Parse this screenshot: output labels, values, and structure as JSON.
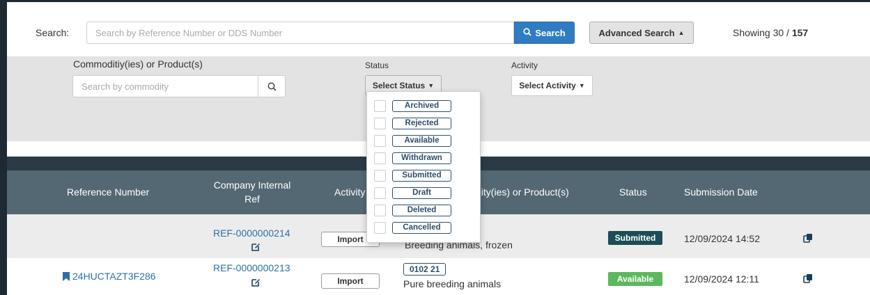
{
  "search": {
    "label": "Search:",
    "placeholder": "Search by Reference Number or DDS Number",
    "button_label": "Search",
    "advanced_label": "Advanced Search",
    "showing_prefix": "Showing 30 / ",
    "showing_total": "157"
  },
  "advanced": {
    "commodity_label": "Commoditiy(ies) or Product(s)",
    "commodity_placeholder": "Search by commodity",
    "status_label": "Status",
    "status_button": "Select Status",
    "activity_label": "Activity",
    "activity_button": "Select Activity"
  },
  "status_options": [
    "Archived",
    "Rejected",
    "Available",
    "Withdrawn",
    "Submitted",
    "Draft",
    "Deleted",
    "Cancelled"
  ],
  "table": {
    "headers": {
      "reference": "Reference Number",
      "internal_ref_1": "Company Internal",
      "internal_ref_2": "Ref",
      "activity": "Activity",
      "commodity": "Commodity(ies) or Product(s)",
      "status": "Status",
      "date": "Submission Date"
    },
    "rows": [
      {
        "reference": "",
        "internal_ref": "REF-0000000214",
        "activity": "Import",
        "code": "",
        "commodity": "Breeding animals, frozen",
        "status": "Submitted",
        "date": "12/09/2024 14:52"
      },
      {
        "reference": "24HUCTAZT3F286",
        "internal_ref": "REF-0000000213",
        "activity": "Import",
        "code": "0102 21",
        "commodity": "Pure breeding animals",
        "status": "Available",
        "date": "12/09/2024 12:11"
      }
    ]
  },
  "colors": {
    "primary": "#2f7cc2",
    "header_bg": "#546873",
    "submitted": "#1b4d56",
    "available": "#5cb85c",
    "link": "#2e6fa8"
  }
}
